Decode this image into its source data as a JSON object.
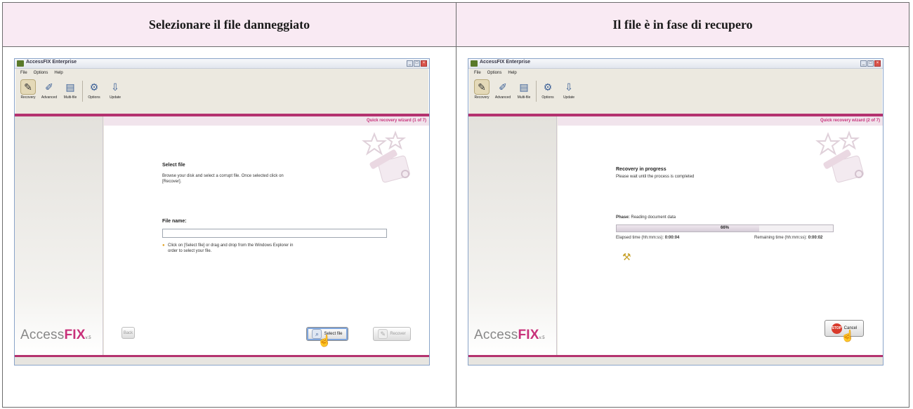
{
  "columns": [
    {
      "header": "Selezionare il file danneggiato",
      "window": {
        "title": "AccessFIX Enterprise",
        "menu": [
          "File",
          "Options",
          "Help"
        ],
        "toolbar": [
          "Recovery",
          "Advanced",
          "Multi-file",
          "Options",
          "Update"
        ],
        "wizard_step": "Quick recovery wizard (1 of 7)",
        "logo": {
          "prefix": "Access",
          "brand": "FIX",
          "suffix": "v.5"
        }
      },
      "content": {
        "heading": "Select file",
        "description": "Browse your disk and select a corrupt file. Once selected click on [Recover].",
        "file_name_label": "File name:",
        "file_name_value": "",
        "hint": "Click on [Select file] or drag and drop from the Windows Explorer in order to select your file.",
        "back_button": "Back",
        "select_button": "Select file",
        "recover_button": "Recover"
      }
    },
    {
      "header": "Il file è in fase di recupero",
      "window": {
        "title": "AccessFIX Enterprise",
        "menu": [
          "File",
          "Options",
          "Help"
        ],
        "toolbar": [
          "Recovery",
          "Advanced",
          "Multi-file",
          "Options",
          "Update"
        ],
        "wizard_step": "Quick recovery wizard (2 of 7)",
        "logo": {
          "prefix": "Access",
          "brand": "FIX",
          "suffix": "v.5"
        }
      },
      "content": {
        "heading": "Recovery in progress",
        "description": "Please wait until the process is completed",
        "phase_label": "Phase:",
        "phase_value": "Reading document data",
        "progress_percent": 66,
        "progress_text": "66%",
        "elapsed_label": "Elapsed time (hh:mm:ss):",
        "elapsed_value": "0:00:04",
        "remaining_label": "Remaining time (hh:mm:ss):",
        "remaining_value": "0:00:02",
        "stop_badge": "STOP",
        "cancel_button": "Cancel"
      }
    }
  ],
  "colors": {
    "accent": "#b4326f",
    "header_bg": "#f9eaf3",
    "brand": "#c8317a"
  }
}
